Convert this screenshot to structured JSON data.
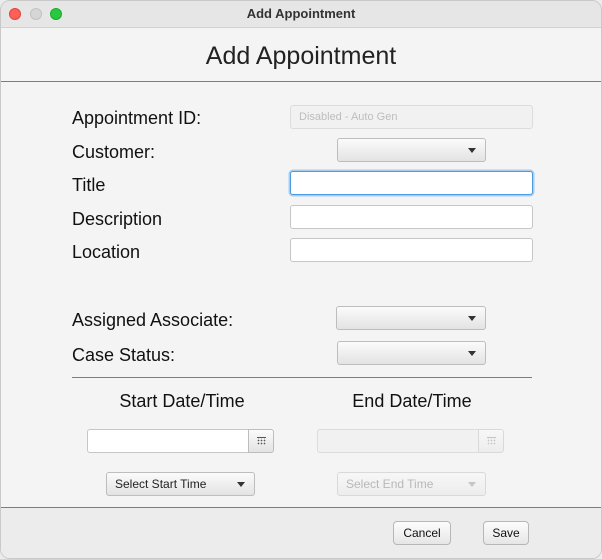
{
  "window": {
    "title": "Add Appointment"
  },
  "heading": "Add Appointment",
  "form": {
    "appointment_id": {
      "label": "Appointment ID:",
      "placeholder": "Disabled - Auto Gen"
    },
    "customer": {
      "label": "Customer:",
      "value": ""
    },
    "title": {
      "label": "Title",
      "value": ""
    },
    "description": {
      "label": "Description",
      "value": ""
    },
    "location": {
      "label": "Location",
      "value": ""
    },
    "assigned_associate": {
      "label": "Assigned Associate:",
      "value": ""
    },
    "case_status": {
      "label": "Case Status:",
      "value": ""
    }
  },
  "schedule": {
    "start_heading": "Start Date/Time",
    "end_heading": "End Date/Time",
    "start_date": "",
    "end_date": "",
    "start_time_label": "Select Start Time",
    "end_time_label": "Select End Time"
  },
  "footer": {
    "cancel_label": "Cancel",
    "save_label": "Save"
  },
  "icons": {
    "date_picker": "calendar-icon",
    "dropdown": "chevron-down-icon"
  },
  "colors": {
    "focus_ring": "#4a9be0",
    "close": "#fe5f57",
    "maximize": "#28c840"
  }
}
